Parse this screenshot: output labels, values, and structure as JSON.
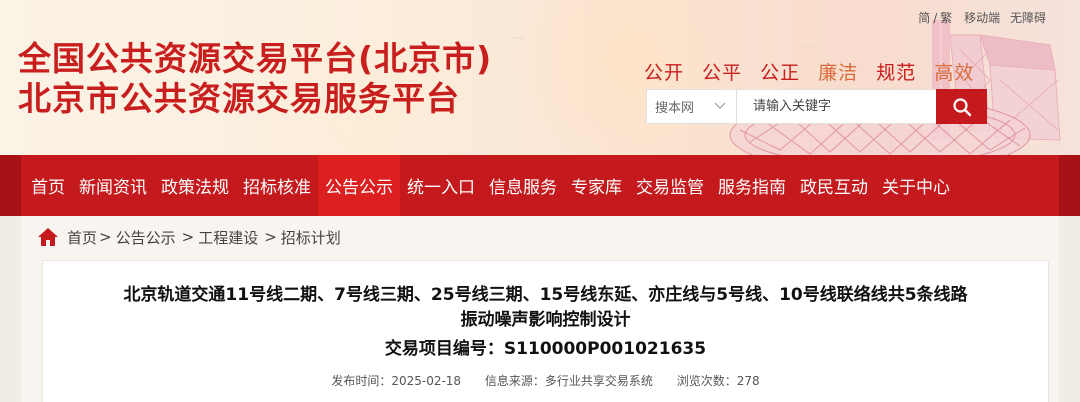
{
  "header": {
    "title_line1": "全国公共资源交易平台(北京市)",
    "title_line2": "北京市公共资源交易服务平台",
    "utility": {
      "simplified": "简",
      "separator": "/",
      "traditional": "繁",
      "mobile": "移动端",
      "accessibility": "无障碍"
    },
    "slogans": [
      "公开",
      "公平",
      "公正",
      "廉洁",
      "规范",
      "高效"
    ]
  },
  "search": {
    "select_value": "搜本网",
    "placeholder": "请输入关键字",
    "button_icon": "search-icon"
  },
  "nav": {
    "items": [
      {
        "label": "首页"
      },
      {
        "label": "新闻资讯"
      },
      {
        "label": "政策法规"
      },
      {
        "label": "招标核准"
      },
      {
        "label": "公告公示",
        "active": true
      },
      {
        "label": "统一入口"
      },
      {
        "label": "信息服务"
      },
      {
        "label": "专家库"
      },
      {
        "label": "交易监管"
      },
      {
        "label": "服务指南"
      },
      {
        "label": "政民互动"
      },
      {
        "label": "关于中心"
      }
    ]
  },
  "breadcrumb": [
    "首页",
    "公告公示",
    "工程建设",
    "招标计划"
  ],
  "article": {
    "title_line1": "北京轨道交通11号线二期、7号线三期、25号线三期、15号线东延、亦庄线与5号线、10号线联络线共5条线路",
    "title_line2": "振动噪声影响控制设计",
    "code_label": "交易项目编号：",
    "code_value": "S110000P001021635",
    "meta": {
      "date_label": "发布时间：",
      "date_value": "2025-02-18",
      "source_label": "信息来源：",
      "source_value": "多行业共享交易系统",
      "views_label": "浏览次数：",
      "views_value": "278"
    }
  },
  "colors": {
    "brand_red": "#c41a1d",
    "nav_active": "#dc1f1f",
    "title_red": "#c81e1e"
  }
}
